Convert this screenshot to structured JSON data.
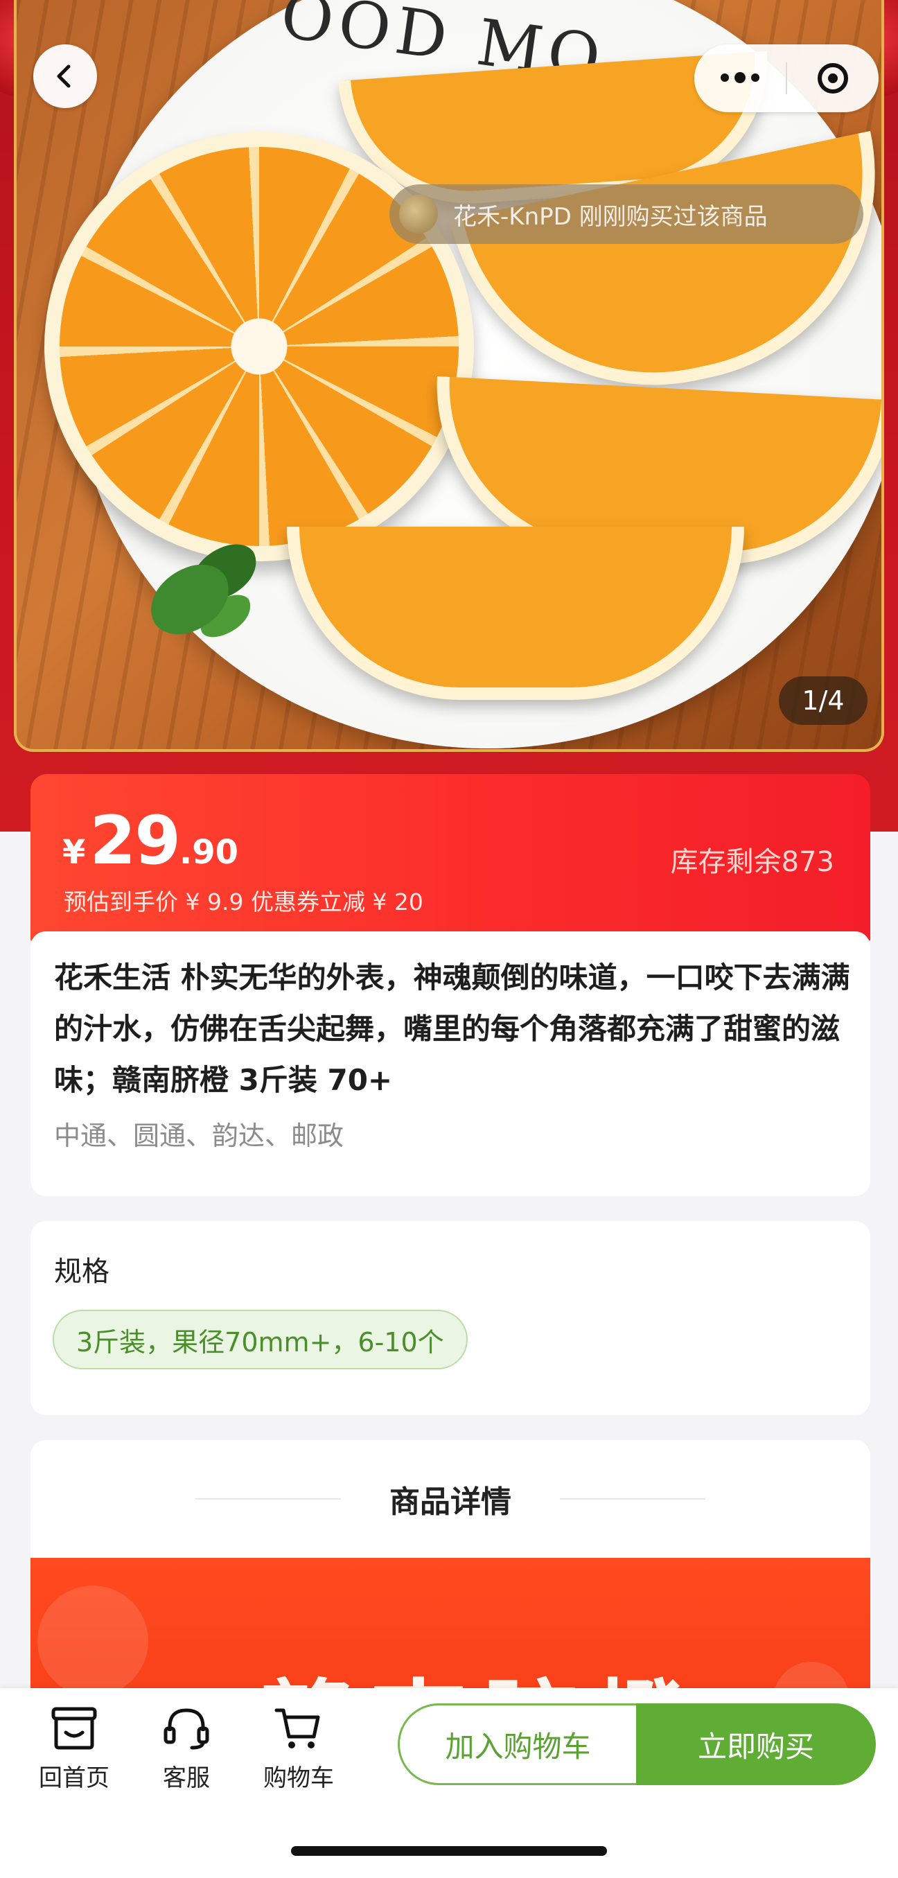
{
  "gallery": {
    "counter": "1/4",
    "plate_text": "OOD MO",
    "toast": "花禾-KnPD 刚刚购买过该商品"
  },
  "price": {
    "currency": "¥",
    "integer": "29",
    "decimal": ".90",
    "estimate": "预估到手价 ¥ 9.9 优惠券立减 ¥ 20",
    "stock": "库存剩余873"
  },
  "product": {
    "title": "花禾生活 朴实无华的外表，神魂颠倒的味道，一口咬下去满满的汁水，仿佛在舌尖起舞，嘴里的每个角落都充满了甜蜜的滋味；赣南脐橙 3斤装 70+",
    "couriers": "中通、圆通、韵达、邮政"
  },
  "spec": {
    "label": "规格",
    "selected": "3斤装，果径70mm+，6-10个"
  },
  "detail": {
    "title": "商品详情",
    "banner_text": "赣南脐橙"
  },
  "bottom_bar": {
    "home": "回首页",
    "service": "客服",
    "cart": "购物车",
    "add_to_cart": "加入购物车",
    "buy_now": "立即购买"
  },
  "colors": {
    "accent_red": "#fb2c2b",
    "accent_green": "#5fad34"
  },
  "icons": {
    "back": "chevron-left-icon",
    "more": "more-dots-icon",
    "close": "target-circle-icon",
    "home": "store-icon",
    "service": "headset-icon",
    "cart": "cart-icon"
  }
}
